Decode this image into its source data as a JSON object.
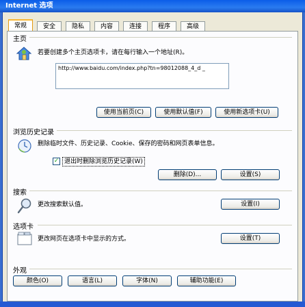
{
  "window": {
    "title": "Internet 选项"
  },
  "tabs": [
    {
      "label": "常规",
      "active": true
    },
    {
      "label": "安全"
    },
    {
      "label": "隐私"
    },
    {
      "label": "内容"
    },
    {
      "label": "连接"
    },
    {
      "label": "程序"
    },
    {
      "label": "高级"
    }
  ],
  "home_page": {
    "section": "主页",
    "description": "若要创建多个主页选项卡，请在每行输入一个地址(R)。",
    "url_value": "http://www.baidu.com/index.php?tn=98012088_4_d _",
    "use_current": "使用当前页(C)",
    "use_default": "使用默认值(F)",
    "use_blank": "使用新选项卡(U)"
  },
  "browsing_history": {
    "section": "浏览历史记录",
    "description": "删除临时文件、历史记录、Cookie、保存的密码和网页表单信息。",
    "delete_on_exit_label": "退出时删除浏览历史记录(W)",
    "delete_on_exit_checked": true,
    "delete_button": "删除(D)...",
    "settings_button": "设置(S)"
  },
  "search": {
    "section": "搜索",
    "description": "更改搜索默认值。",
    "settings_button": "设置(I)"
  },
  "tabs_group": {
    "section": "选项卡",
    "description": "更改网页在选项卡中显示的方式。",
    "settings_button": "设置(T)"
  },
  "appearance": {
    "section": "外观",
    "colors": "颜色(O)",
    "languages": "语言(L)",
    "fonts": "字体(N)",
    "accessibility": "辅助功能(E)"
  },
  "colors": {
    "accent": "#f7b634",
    "link_blue": "#1b4fc4"
  }
}
